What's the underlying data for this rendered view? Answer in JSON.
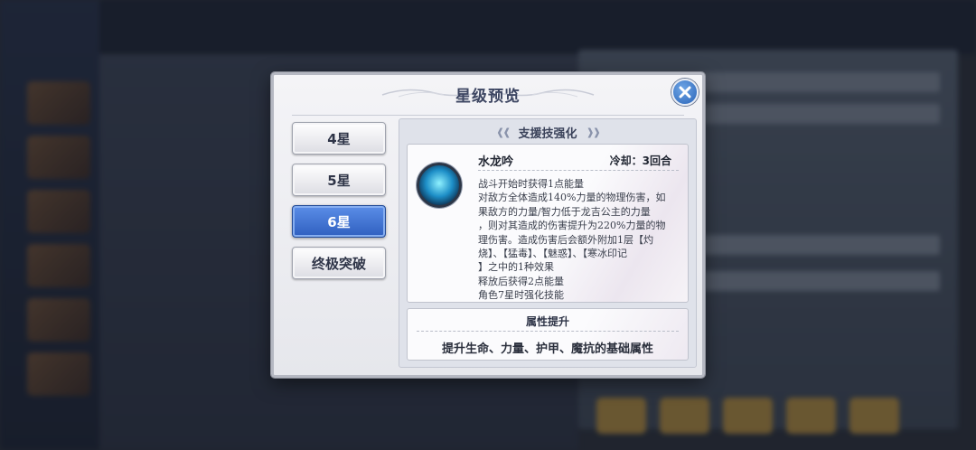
{
  "dialog": {
    "title": "星级预览",
    "tabs": [
      {
        "label": "4星",
        "active": false
      },
      {
        "label": "5星",
        "active": false
      },
      {
        "label": "6星",
        "active": true
      },
      {
        "label": "终极突破",
        "active": false
      }
    ],
    "section_title": "支援技强化",
    "skill": {
      "name": "水龙吟",
      "cooldown": "冷却：3回合",
      "description_lines": [
        "战斗开始时获得1点能量",
        "对敌方全体造成140%力量的物理伤害，如",
        "果敌方的力量/智力低于龙吉公主的力量",
        "，则对其造成的伤害提升为220%力量的物",
        "理伤害。造成伤害后会额外附加1层【灼",
        "烧】、【猛毒】、【魅惑】、【寒冰印记",
        "】之中的1种效果",
        "释放后获得2点能量",
        "角色7星时强化技能"
      ]
    },
    "attribute": {
      "title": "属性提升",
      "text": "提升生命、力量、护甲、魔抗的基础属性"
    }
  },
  "colors": {
    "active_tab": "#3f72d6",
    "close_button": "#2a64b8",
    "title_text": "#3d4662"
  },
  "icons": [
    "close-icon",
    "skill-icon"
  ]
}
